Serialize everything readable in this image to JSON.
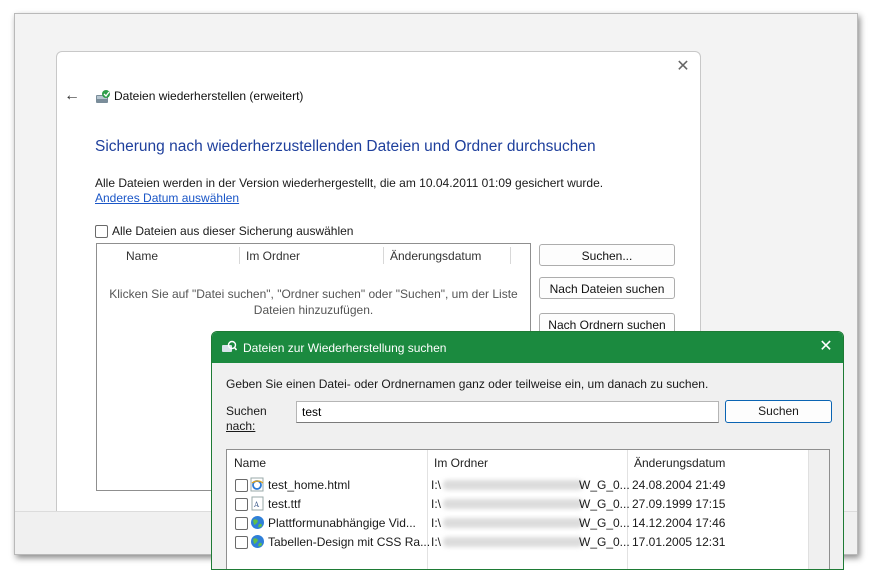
{
  "wizard": {
    "title": "Dateien wiederherstellen (erweitert)",
    "close_glyph": "✕",
    "back_glyph": "←",
    "heading": "Sicherung nach wiederherzustellenden Dateien und Ordner durchsuchen",
    "info_text": "Alle Dateien werden in der Version wiederhergestellt, die am 10.04.2011 01:09 gesichert wurde.",
    "change_date_link": "Anderes Datum auswählen",
    "select_all_label": "Alle Dateien aus dieser Sicherung auswählen",
    "list": {
      "columns": [
        "Name",
        "Im Ordner",
        "Änderungsdatum"
      ],
      "empty_line1": "Klicken Sie auf \"Datei suchen\", \"Ordner suchen\" oder \"Suchen\", um der Liste",
      "empty_line2": "Dateien hinzuzufügen."
    },
    "buttons": {
      "search": "Suchen...",
      "search_files": "Nach Dateien suchen",
      "search_folders": "Nach Ordnern suchen"
    }
  },
  "dialog": {
    "title": "Dateien zur Wiederherstellung suchen",
    "close_glyph": "✕",
    "instruction": "Geben Sie einen Datei- oder Ordnernamen ganz oder teilweise ein, um danach zu suchen.",
    "search_label_line1": "Suchen",
    "search_label_line2": "nach:",
    "search_value": "test",
    "search_button": "Suchen",
    "results": {
      "columns": [
        "Name",
        "Im Ordner",
        "Änderungsdatum"
      ],
      "rows": [
        {
          "name": "test_home.html",
          "folder_start": "I:\\",
          "folder_end": "W_G_0...",
          "date": "24.08.2004 21:49",
          "icon": "ie-html-icon"
        },
        {
          "name": "test.ttf",
          "folder_start": "I:\\",
          "folder_end": "W_G_0...",
          "date": "27.09.1999 17:15",
          "icon": "font-file-icon"
        },
        {
          "name": "Plattformunabhängige Vid...",
          "folder_start": "I:\\",
          "folder_end": "W_G_0...",
          "date": "14.12.2004 17:46",
          "icon": "globe-icon"
        },
        {
          "name": "Tabellen-Design mit CSS Ra...",
          "folder_start": "I:\\",
          "folder_end": "W_G_0...",
          "date": "17.01.2005 12:31",
          "icon": "globe-icon"
        }
      ]
    }
  },
  "colors": {
    "heading_blue": "#1e3f9c",
    "link_blue": "#1a56c7",
    "dialog_titlebar_green": "#1b8a3f"
  }
}
